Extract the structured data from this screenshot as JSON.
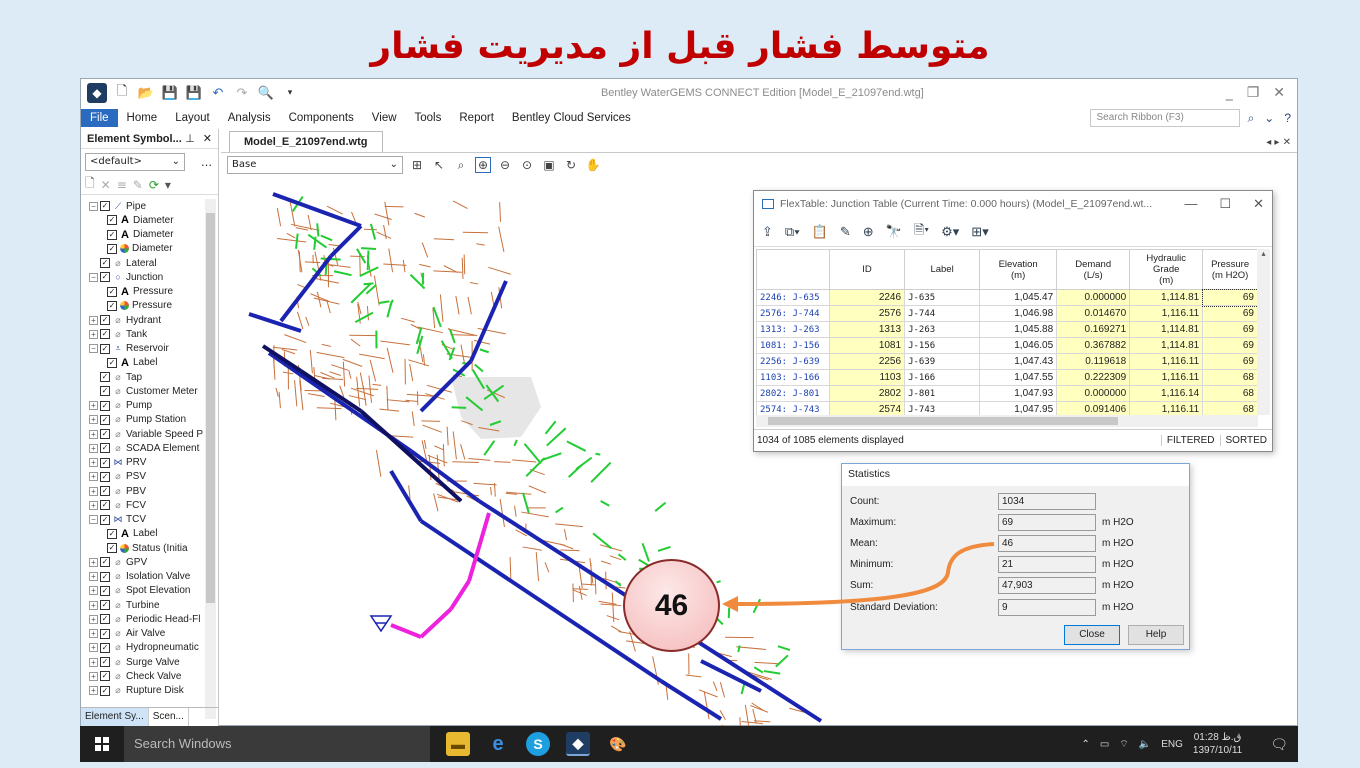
{
  "slide": {
    "title": "متوسط فشار قبل از مدیریت فشار"
  },
  "app": {
    "window_title": "Bentley WaterGEMS CONNECT Edition [Model_E_21097end.wtg]",
    "menu": [
      "File",
      "Home",
      "Layout",
      "Analysis",
      "Components",
      "View",
      "Tools",
      "Report",
      "Bentley Cloud Services"
    ],
    "search_placeholder": "Search Ribbon (F3)"
  },
  "left_panel": {
    "title": "Element Symbol...",
    "select_value": "<default>",
    "tree": [
      {
        "label": "Pipe",
        "level": 0,
        "exp": "-",
        "icon": "pipe"
      },
      {
        "label": "Diameter",
        "level": 1,
        "icon": "A"
      },
      {
        "label": "Diameter",
        "level": 1,
        "icon": "A"
      },
      {
        "label": "Diameter",
        "level": 1,
        "icon": "pie"
      },
      {
        "label": "Lateral",
        "level": 0,
        "icon": "o"
      },
      {
        "label": "Junction",
        "level": 0,
        "exp": "-",
        "icon": "junction"
      },
      {
        "label": "Pressure",
        "level": 1,
        "icon": "A"
      },
      {
        "label": "Pressure",
        "level": 1,
        "icon": "pie"
      },
      {
        "label": "Hydrant",
        "level": 0,
        "exp": "+",
        "icon": "o"
      },
      {
        "label": "Tank",
        "level": 0,
        "exp": "+",
        "icon": "o"
      },
      {
        "label": "Reservoir",
        "level": 0,
        "exp": "-",
        "icon": "reservoir"
      },
      {
        "label": "Label",
        "level": 1,
        "icon": "A"
      },
      {
        "label": "Tap",
        "level": 0,
        "icon": "o"
      },
      {
        "label": "Customer Meter",
        "level": 0,
        "icon": "o"
      },
      {
        "label": "Pump",
        "level": 0,
        "exp": "+",
        "icon": "o"
      },
      {
        "label": "Pump Station",
        "level": 0,
        "exp": "+",
        "icon": "o"
      },
      {
        "label": "Variable Speed P",
        "level": 0,
        "exp": "+",
        "icon": "o"
      },
      {
        "label": "SCADA Element",
        "level": 0,
        "exp": "+",
        "icon": "o"
      },
      {
        "label": "PRV",
        "level": 0,
        "exp": "+",
        "icon": "valve"
      },
      {
        "label": "PSV",
        "level": 0,
        "exp": "+",
        "icon": "o"
      },
      {
        "label": "PBV",
        "level": 0,
        "exp": "+",
        "icon": "o"
      },
      {
        "label": "FCV",
        "level": 0,
        "exp": "+",
        "icon": "o"
      },
      {
        "label": "TCV",
        "level": 0,
        "exp": "-",
        "icon": "valve"
      },
      {
        "label": "Label",
        "level": 1,
        "icon": "A"
      },
      {
        "label": "Status (Initia",
        "level": 1,
        "icon": "pie"
      },
      {
        "label": "GPV",
        "level": 0,
        "exp": "+",
        "icon": "o"
      },
      {
        "label": "Isolation Valve",
        "level": 0,
        "exp": "+",
        "icon": "o"
      },
      {
        "label": "Spot Elevation",
        "level": 0,
        "exp": "+",
        "icon": "o"
      },
      {
        "label": "Turbine",
        "level": 0,
        "exp": "+",
        "icon": "o"
      },
      {
        "label": "Periodic Head-Fl",
        "level": 0,
        "exp": "+",
        "icon": "o"
      },
      {
        "label": "Air Valve",
        "level": 0,
        "exp": "+",
        "icon": "o"
      },
      {
        "label": "Hydropneumatic",
        "level": 0,
        "exp": "+",
        "icon": "o"
      },
      {
        "label": "Surge Valve",
        "level": 0,
        "exp": "+",
        "icon": "o"
      },
      {
        "label": "Check Valve",
        "level": 0,
        "exp": "+",
        "icon": "o"
      },
      {
        "label": "Rupture Disk",
        "level": 0,
        "exp": "+",
        "icon": "o"
      }
    ],
    "tabs": [
      "Element Sy...",
      "Scen..."
    ]
  },
  "document": {
    "tab": "Model_E_21097end.wtg",
    "scenario": "Base"
  },
  "flextable": {
    "title": "FlexTable: Junction Table (Current Time: 0.000 hours) (Model_E_21097end.wt...",
    "headers": [
      "",
      "ID",
      "Label",
      "Elevation\n(m)",
      "Demand\n(L/s)",
      "Hydraulic\nGrade\n(m)",
      "Pressure\n(m H2O)"
    ],
    "rows": [
      [
        "2246: J-635",
        "2246",
        "J-635",
        "1,045.47",
        "0.000000",
        "1,114.81",
        "69"
      ],
      [
        "2576: J-744",
        "2576",
        "J-744",
        "1,046.98",
        "0.014670",
        "1,116.11",
        "69"
      ],
      [
        "1313: J-263",
        "1313",
        "J-263",
        "1,045.88",
        "0.169271",
        "1,114.81",
        "69"
      ],
      [
        "1081: J-156",
        "1081",
        "J-156",
        "1,046.05",
        "0.367882",
        "1,114.81",
        "69"
      ],
      [
        "2256: J-639",
        "2256",
        "J-639",
        "1,047.43",
        "0.119618",
        "1,116.11",
        "69"
      ],
      [
        "1103: J-166",
        "1103",
        "J-166",
        "1,047.55",
        "0.222309",
        "1,116.11",
        "68"
      ],
      [
        "2802: J-801",
        "2802",
        "J-801",
        "1,047.93",
        "0.000000",
        "1,116.14",
        "68"
      ],
      [
        "2574: J-743",
        "2574",
        "J-743",
        "1,047.95",
        "0.091406",
        "1,116.11",
        "68"
      ]
    ],
    "status": "1034 of 1085 elements displayed",
    "flags": [
      "FILTERED",
      "SORTED"
    ]
  },
  "statistics": {
    "title": "Statistics",
    "rows": [
      {
        "label": "Count:",
        "value": "1034",
        "unit": ""
      },
      {
        "label": "Maximum:",
        "value": "69",
        "unit": "m H2O"
      },
      {
        "label": "Mean:",
        "value": "46",
        "unit": "m H2O"
      },
      {
        "label": "Minimum:",
        "value": "21",
        "unit": "m H2O"
      },
      {
        "label": "Sum:",
        "value": "47,903",
        "unit": "m H2O"
      },
      {
        "label": "Standard Deviation:",
        "value": "9",
        "unit": "m H2O"
      }
    ],
    "close_label": "Close",
    "help_label": "Help"
  },
  "callout": {
    "value": "46",
    "color": "#f08a3c"
  },
  "taskbar": {
    "search": "Search Windows",
    "lang": "ENG",
    "time": "01:28 ق.ظ",
    "date": "1397/10/11"
  }
}
